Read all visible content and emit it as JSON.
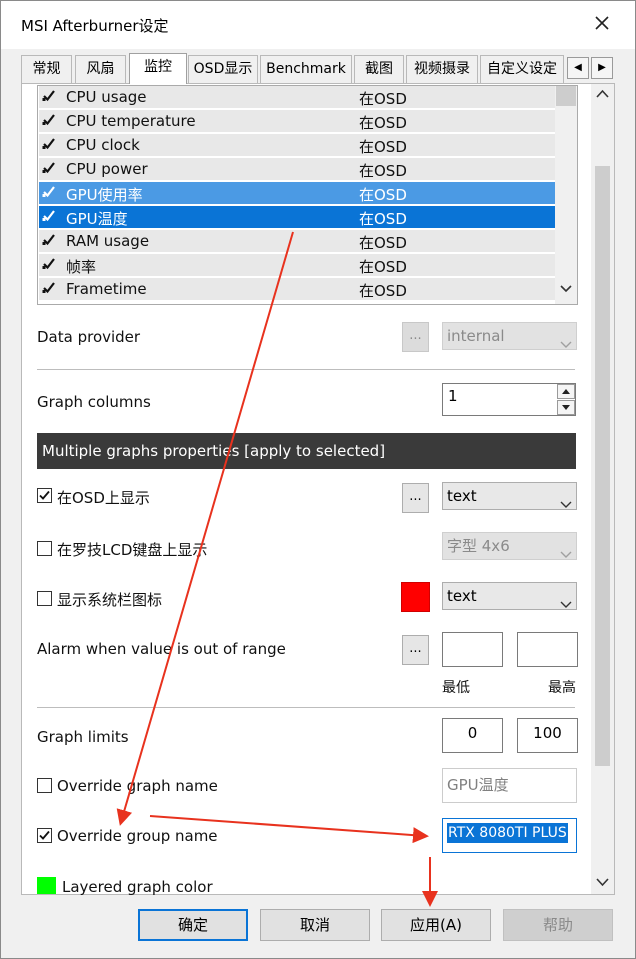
{
  "window": {
    "title": "MSI Afterburner设定"
  },
  "tabs": [
    {
      "label": "常规"
    },
    {
      "label": "风扇"
    },
    {
      "label": "监控"
    },
    {
      "label": "OSD显示"
    },
    {
      "label": "Benchmark"
    },
    {
      "label": "截图"
    },
    {
      "label": "视频摄录"
    },
    {
      "label": "自定义设定"
    }
  ],
  "monitor_list": {
    "rows": [
      {
        "name": "CPU usage",
        "osd": "在OSD"
      },
      {
        "name": "CPU temperature",
        "osd": "在OSD"
      },
      {
        "name": "CPU clock",
        "osd": "在OSD"
      },
      {
        "name": "CPU power",
        "osd": "在OSD"
      },
      {
        "name": "GPU使用率",
        "osd": "在OSD"
      },
      {
        "name": "GPU温度",
        "osd": "在OSD"
      },
      {
        "name": "RAM usage",
        "osd": "在OSD"
      },
      {
        "name": "帧率",
        "osd": "在OSD"
      },
      {
        "name": "Frametime",
        "osd": "在OSD"
      }
    ]
  },
  "data_provider": {
    "label": "Data provider",
    "button": "...",
    "value": "internal"
  },
  "graph_columns": {
    "label": "Graph columns",
    "value": "1"
  },
  "multi_graph_header": "Multiple graphs properties  [apply to selected]",
  "show_in_osd": {
    "label": "在OSD上显示",
    "button": "...",
    "value": "text"
  },
  "show_in_lcd": {
    "label": "在罗技LCD键盘上显示",
    "value": "字型 4x6"
  },
  "show_tray": {
    "label": "显示系统栏图标",
    "value": "text"
  },
  "alarm": {
    "label": "Alarm when value is out of range",
    "button": "...",
    "min_label": "最低",
    "max_label": "最高"
  },
  "graph_limits": {
    "label": "Graph limits",
    "min": "0",
    "max": "100"
  },
  "override_graph_name": {
    "label": "Override graph name",
    "value": "GPU温度"
  },
  "override_group_name": {
    "label": "Override group name",
    "value": "RTX 8080TI PLUS"
  },
  "layered_color": {
    "label": "Layered graph color"
  },
  "buttons": {
    "ok": "确定",
    "cancel": "取消",
    "apply": "应用(A)",
    "help": "帮助"
  },
  "colors": {
    "selection": "#0a74d6",
    "selection_light": "#4b9ae4",
    "arrow_red": "#e8321e",
    "header_dark": "#3a3a3a",
    "tray_color": "#ff0000",
    "layered_color": "#00ff00"
  }
}
